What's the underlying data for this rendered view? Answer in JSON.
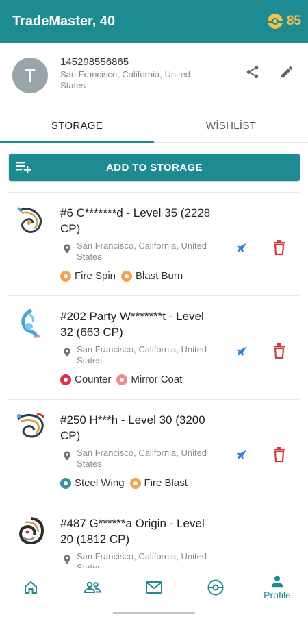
{
  "appbar": {
    "title": "TradeMaster, 40",
    "coins": "85",
    "coin_icon": "pokeball-coin-icon"
  },
  "profile": {
    "avatar_letter": "T",
    "id": "145298556865",
    "location": "San Francisco, California, United States",
    "actions": [
      "share-icon",
      "edit-icon"
    ]
  },
  "tabs": [
    {
      "label": "STORAGE",
      "active": true
    },
    {
      "label": "WİSHLİST",
      "active": false
    }
  ],
  "add_button": {
    "label": "ADD TO STORAGE",
    "icon": "playlist-add-icon"
  },
  "items": [
    {
      "title": "#6 C*******d - Level 35 (2228 CP)",
      "location": "San Francisco, California, United States",
      "moves": [
        {
          "name": "Fire Spin",
          "color": "#f5a04a"
        },
        {
          "name": "Blast Burn",
          "color": "#f5a04a"
        }
      ],
      "thumb_colors": [
        "#2c3e50",
        "#c9a04a"
      ]
    },
    {
      "title": "#202 Party W*******t - Level 32 (663 CP)",
      "location": "San Francisco, California, United States",
      "moves": [
        {
          "name": "Counter",
          "color": "#d6344a"
        },
        {
          "name": "Mirror Coat",
          "color": "#f08a90"
        }
      ],
      "thumb_colors": [
        "#4aa3d8",
        "#7dc8ee"
      ]
    },
    {
      "title": "#250 H***h - Level 30 (3200 CP)",
      "location": "San Francisco, California, United States",
      "moves": [
        {
          "name": "Steel Wing",
          "color": "#3f8fa3"
        },
        {
          "name": "Fire Blast",
          "color": "#f5a04a"
        }
      ],
      "thumb_colors": [
        "#2c3e50",
        "#d9a640"
      ]
    },
    {
      "title": "#487 G******a Origin - Level 20 (1812 CP)",
      "location": "San Francisco, California, United States",
      "moves": [],
      "thumb_colors": [
        "#2b2b2b",
        "#c9a04a"
      ]
    }
  ],
  "bottom_nav": [
    {
      "icon": "home-icon",
      "label": ""
    },
    {
      "icon": "people-icon",
      "label": ""
    },
    {
      "icon": "mail-icon",
      "label": ""
    },
    {
      "icon": "pokeball-icon",
      "label": ""
    },
    {
      "icon": "profile-icon",
      "label": "Profile"
    }
  ],
  "colors": {
    "accent": "#1e8a92",
    "coin": "#f2c14e",
    "delete": "#d33a3a",
    "send": "#2f86d6"
  }
}
